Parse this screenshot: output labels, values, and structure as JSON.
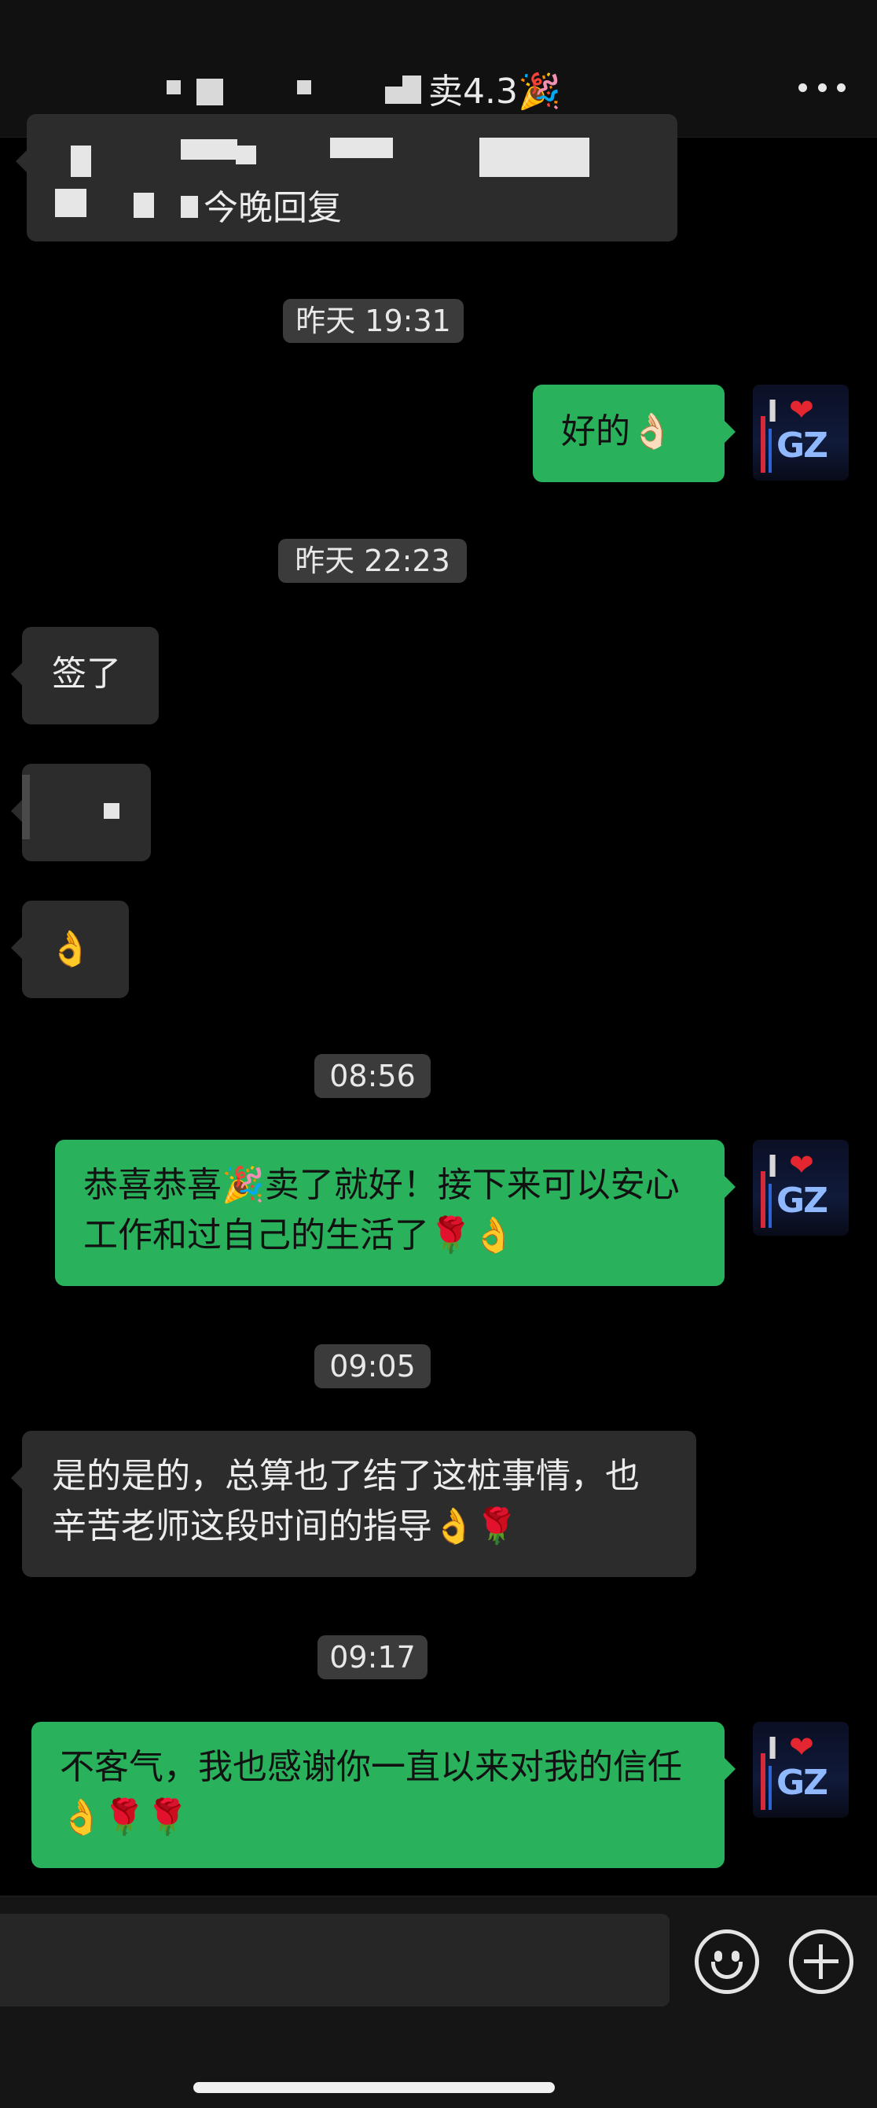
{
  "header": {
    "title": "卖4.3🎉",
    "more_icon": "more-dots-icon"
  },
  "messages": [
    {
      "type": "incoming",
      "text": "今晚回复",
      "note": "partially obscured by mosaic"
    },
    {
      "type": "time",
      "text": "昨天 19:31"
    },
    {
      "type": "outgoing",
      "text": "好的👌🏻"
    },
    {
      "type": "time",
      "text": "昨天 22:23"
    },
    {
      "type": "incoming",
      "text": "签了"
    },
    {
      "type": "incoming",
      "text": ""
    },
    {
      "type": "incoming",
      "text": "👌"
    },
    {
      "type": "time",
      "text": "08:56"
    },
    {
      "type": "outgoing",
      "text": "恭喜恭喜🎉卖了就好！接下来可以安心工作和过自己的生活了🌹👌"
    },
    {
      "type": "time",
      "text": "09:05"
    },
    {
      "type": "incoming",
      "text": "是的是的，总算也了结了这桩事情，也辛苦老师这段时间的指导👌🌹"
    },
    {
      "type": "time",
      "text": "09:17"
    },
    {
      "type": "outgoing",
      "text": "不客气，我也感谢你一直以来对我的信任👌🌹🌹"
    }
  ],
  "avatar": {
    "text_i": "I",
    "text_heart": "❤",
    "text_gz": "GZ"
  },
  "input": {
    "placeholder": "",
    "emoji_icon": "smiley-icon",
    "plus_icon": "plus-circle-icon"
  }
}
